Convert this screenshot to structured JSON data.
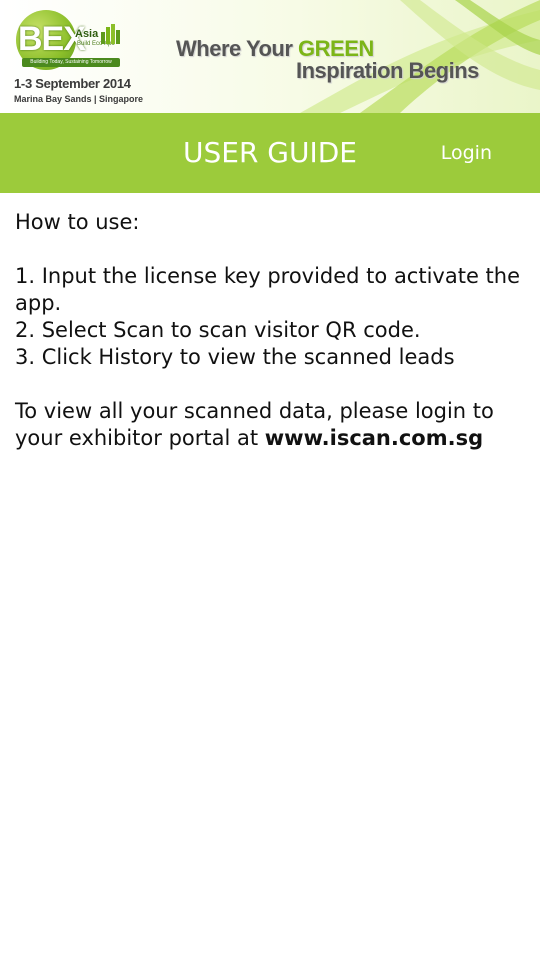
{
  "banner": {
    "logo_bex": "BEX",
    "logo_asia": "Asia",
    "logo_build": "Build Eco Xpo",
    "logo_tagline": "Building Today, Sustaining Tomorrow",
    "event_dates": "1-3 September 2014",
    "event_venue": "Marina Bay Sands | Singapore",
    "slogan_part1": "Where Your ",
    "slogan_green": "GREEN",
    "slogan_part2": "Inspiration Begins",
    "colors": {
      "green": "#7cb518",
      "header_green": "#9ccb3b"
    }
  },
  "header": {
    "title": "USER GUIDE",
    "login_label": "Login"
  },
  "guide": {
    "intro": "How to use:",
    "steps": [
      "1. Input the license key provided to activate the app.",
      "2. Select Scan to scan visitor QR code.",
      "3. Click History to view the scanned leads"
    ],
    "portal_text": "To view all your scanned data, please login to your exhibitor portal at ",
    "portal_link": "www.iscan.com.sg"
  }
}
